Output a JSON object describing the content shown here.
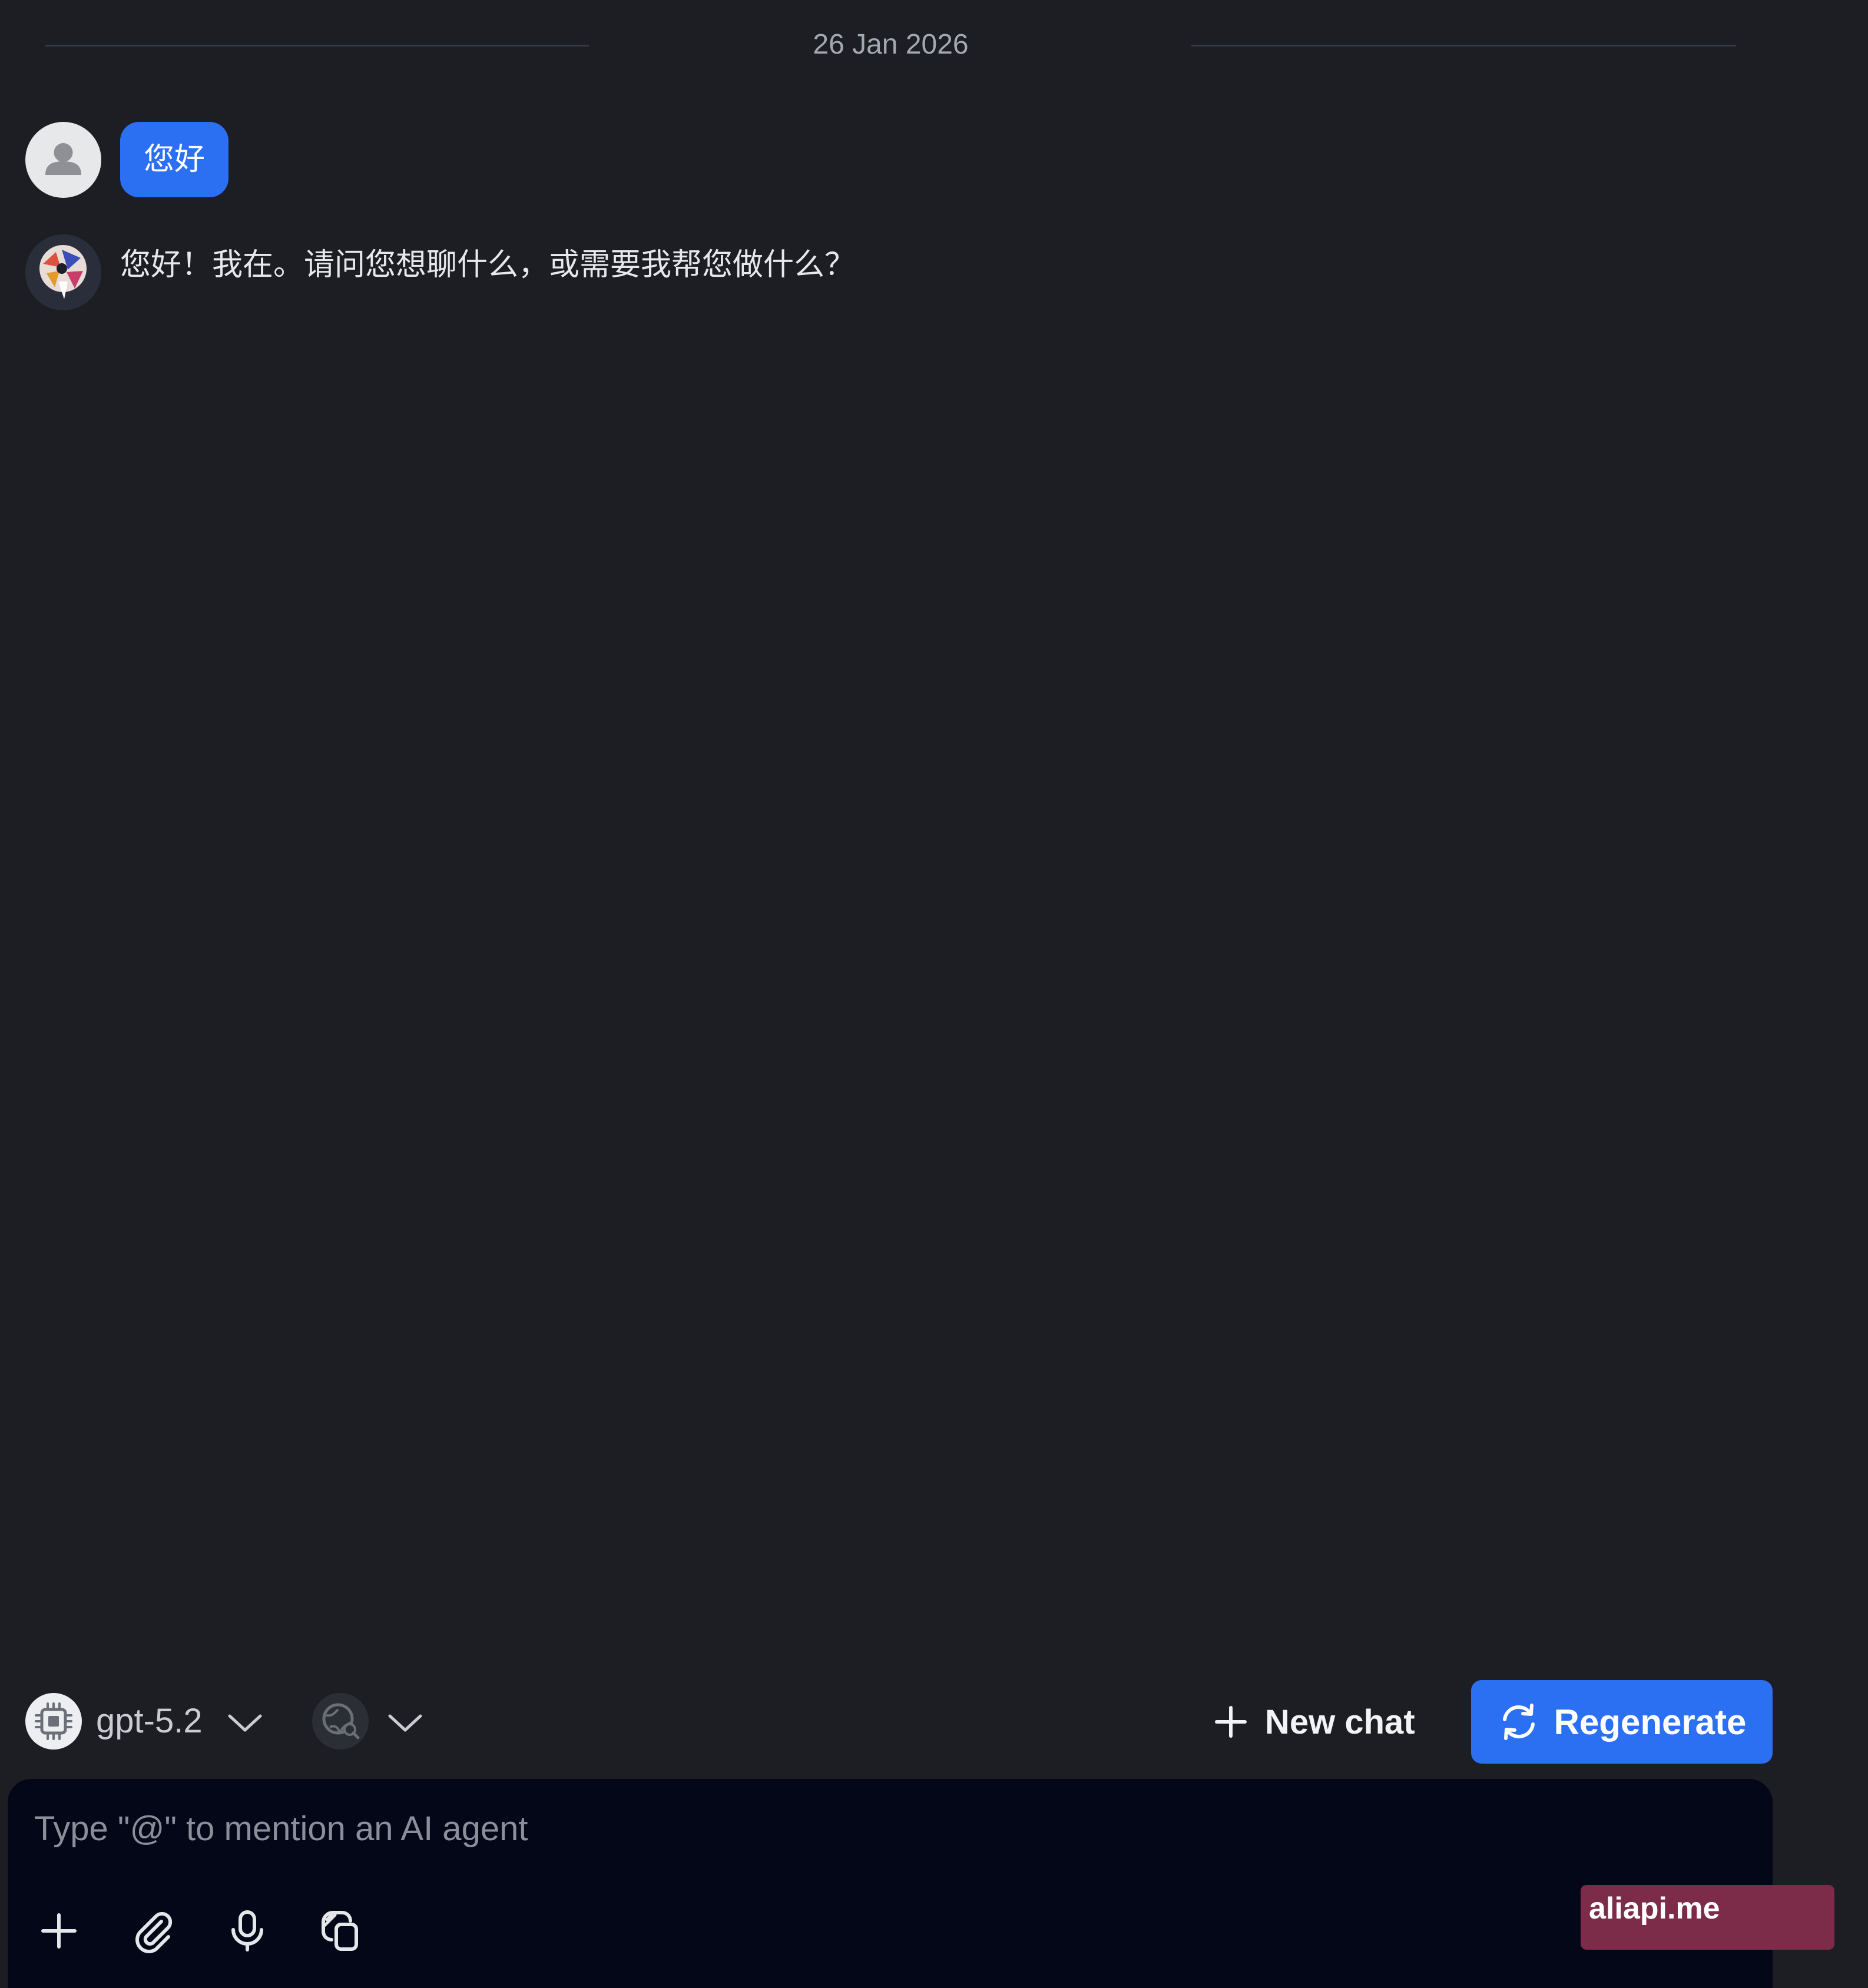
{
  "thread": {
    "date_label": "26 Jan 2026"
  },
  "messages": [
    {
      "role": "user",
      "text": "您好"
    },
    {
      "role": "assistant",
      "text": "您好！我在。请问您想聊什么，或需要我帮您做什么？"
    }
  ],
  "toolbar": {
    "model_name": "gpt-5.2",
    "new_chat_label": "New chat",
    "regenerate_label": "Regenerate"
  },
  "composer": {
    "placeholder": "Type \"@\" to mention an AI agent",
    "value": ""
  },
  "watermark": {
    "text": "aliapi.me"
  },
  "colors": {
    "background": "#1d1e23",
    "accent": "#2b6ff3",
    "composer_bg": "#030718",
    "watermark_bg": "#7c2b48"
  },
  "icons": {
    "user_avatar": "person-icon",
    "assistant_avatar": "agent-avatar-icon",
    "model": "chip-icon",
    "web_search": "globe-search-icon",
    "new_chat": "plus-icon",
    "regenerate": "refresh-icon",
    "composer_tools": [
      "plus-icon",
      "paperclip-icon",
      "microphone-icon",
      "copy-icon"
    ]
  }
}
